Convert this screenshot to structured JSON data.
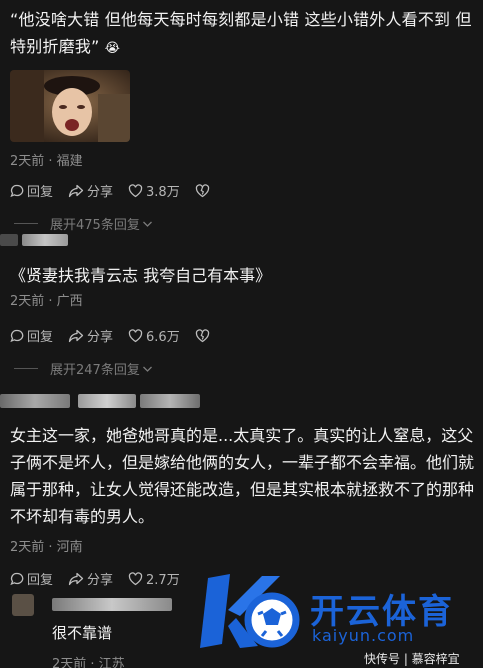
{
  "comments": [
    {
      "text": "“他没啥大错 但他每天每时每刻都是小错 这些小错外人看不到 但特别折磨我”",
      "emoji": "😭",
      "meta": "2天前 · 福建",
      "reply_label": "回复",
      "share_label": "分享",
      "likes": "3.8万",
      "expand": "展开475条回复"
    },
    {
      "text": "《贤妻扶我青云志  我夸自己有本事》",
      "meta": "2天前 · 广西",
      "reply_label": "回复",
      "share_label": "分享",
      "likes": "6.6万",
      "expand": "展开247条回复"
    },
    {
      "text": "女主这一家，她爸她哥真的是...太真实了。真实的让人窒息，这父子俩不是坏人，但是嫁给他俩的女人，一辈子都不会幸福。他们就属于那种，让女人觉得还能改造，但是其实根本就拯救不了的那种不坏却有毒的男人。",
      "meta": "2天前 · 河南",
      "reply_label": "回复",
      "share_label": "分享",
      "likes": "2.7万"
    },
    {
      "text": "很不靠谱",
      "meta": "2天前 · 江苏"
    }
  ],
  "watermark": {
    "brand": "开云体育",
    "site": "kaiyun.com",
    "credit": "快传号 | 慕容梓宜"
  },
  "colors": {
    "background": "#161616",
    "watermark_blue": "#1b63d8"
  }
}
